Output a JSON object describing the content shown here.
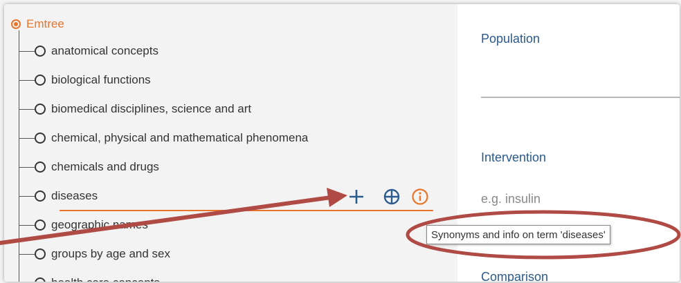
{
  "tree": {
    "root_label": "Emtree",
    "items": [
      {
        "label": "anatomical concepts"
      },
      {
        "label": "biological functions"
      },
      {
        "label": "biomedical disciplines, science and art"
      },
      {
        "label": "chemical, physical and mathematical phenomena"
      },
      {
        "label": "chemicals and drugs"
      },
      {
        "label": "diseases"
      },
      {
        "label": "geographic names"
      },
      {
        "label": "groups by age and sex"
      },
      {
        "label": "health care concepts"
      }
    ],
    "actions": {
      "add_icon": "plus-icon",
      "locate_icon": "crosshair-icon",
      "info_icon": "info-icon"
    },
    "tooltip": "Synonyms and info on term 'diseases'"
  },
  "form": {
    "population_label": "Population",
    "intervention_label": "Intervention",
    "intervention_placeholder": "e.g. insulin",
    "comparison_label": "Comparison"
  },
  "colors": {
    "accent": "#e8752a",
    "label_blue": "#2b5a8c",
    "tree_text": "#333333",
    "annotation_red": "#b04a45"
  }
}
